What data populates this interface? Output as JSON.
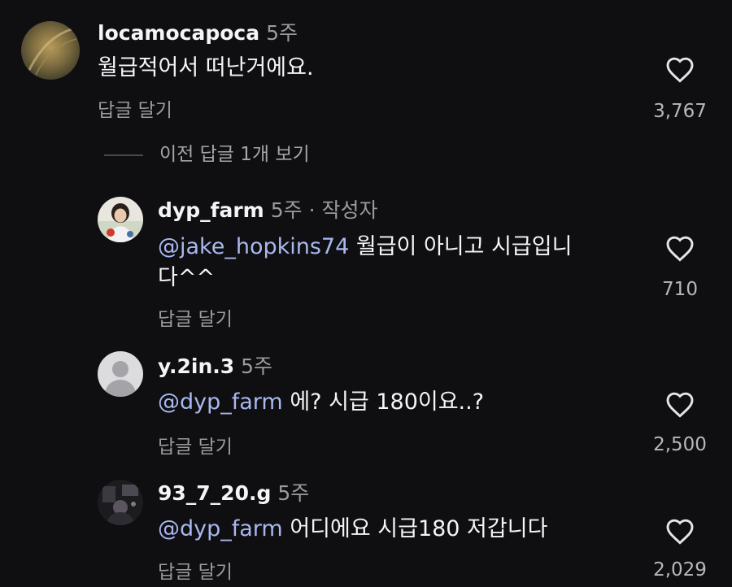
{
  "comments": [
    {
      "username": "locamocapoca",
      "meta": "5주",
      "text": "월급적어서 떠난거에요.",
      "reply_label": "답글 달기",
      "likes": "3,767"
    },
    {
      "username": "dyp_farm",
      "meta": "5주 · 작성자",
      "mention": "@jake_hopkins74",
      "text": " 월급이 아니고 시급입니",
      "text_line2": "다^^",
      "reply_label": "답글 달기",
      "likes": "710"
    },
    {
      "username": "y.2in.3",
      "meta": "5주",
      "mention": "@dyp_farm",
      "text": " 에? 시급 180이요..?",
      "reply_label": "답글 달기",
      "likes": "2,500"
    },
    {
      "username": "93_7_20.g",
      "meta": "5주",
      "mention": "@dyp_farm",
      "text": " 어디에요 시급180 저갑니다",
      "reply_label": "답글 달기",
      "likes": "2,029"
    }
  ],
  "view_replies_label": "이전 답글 1개 보기",
  "icons": {
    "like": "heart-outline-icon",
    "default_avatar": "default-avatar-icon"
  },
  "colors": {
    "background": "#0f0f12",
    "mention": "#a9b8ee",
    "secondary_text": "#9a9a9f"
  }
}
